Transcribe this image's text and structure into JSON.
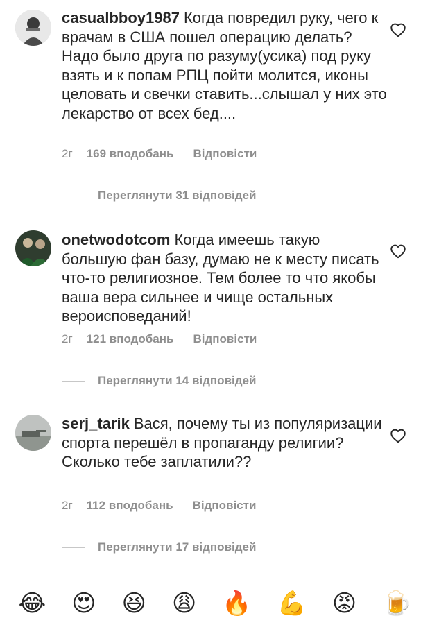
{
  "comments": [
    {
      "username": "casualbboy1987",
      "text": "Когда повредил руку, чего к врачам в США пошел операцию делать? Надо было друга по разуму(усика) под руку взять и к попам РПЦ пойти молится, иконы целовать и свечки ставить...слышал у них это лекарство от всех бед....",
      "time": "2г",
      "likes": "169 вподобань",
      "reply": "Відповісти",
      "view_replies": "Переглянути 31 відповідей"
    },
    {
      "username": "onetwodotcom",
      "text": "Когда имеешь такую большую фан базу, думаю не к месту писать что-то религиозное. Тем более то что якобы ваша вера сильнее и чище остальных вероисповеданий!",
      "time": "2г",
      "likes": "121 вподобань",
      "reply": "Відповісти",
      "view_replies": "Переглянути 14 відповідей"
    },
    {
      "username": "serj_tarik",
      "text": "Вася, почему ты из популяризации спорта перешёл в пропаганду религии? Сколько тебе заплатили??",
      "time": "2г",
      "likes": "112 вподобань",
      "reply": "Відповісти",
      "view_replies": "Переглянути 17 відповідей"
    }
  ],
  "emoji_bar": [
    "😂",
    "😍",
    "😆",
    "😩",
    "🔥",
    "💪",
    "😡",
    "🍺"
  ],
  "icons": {
    "like": "heart-outline-icon"
  },
  "colors": {
    "text": "#262626",
    "secondary": "#8e8e8e",
    "background": "#ffffff"
  }
}
